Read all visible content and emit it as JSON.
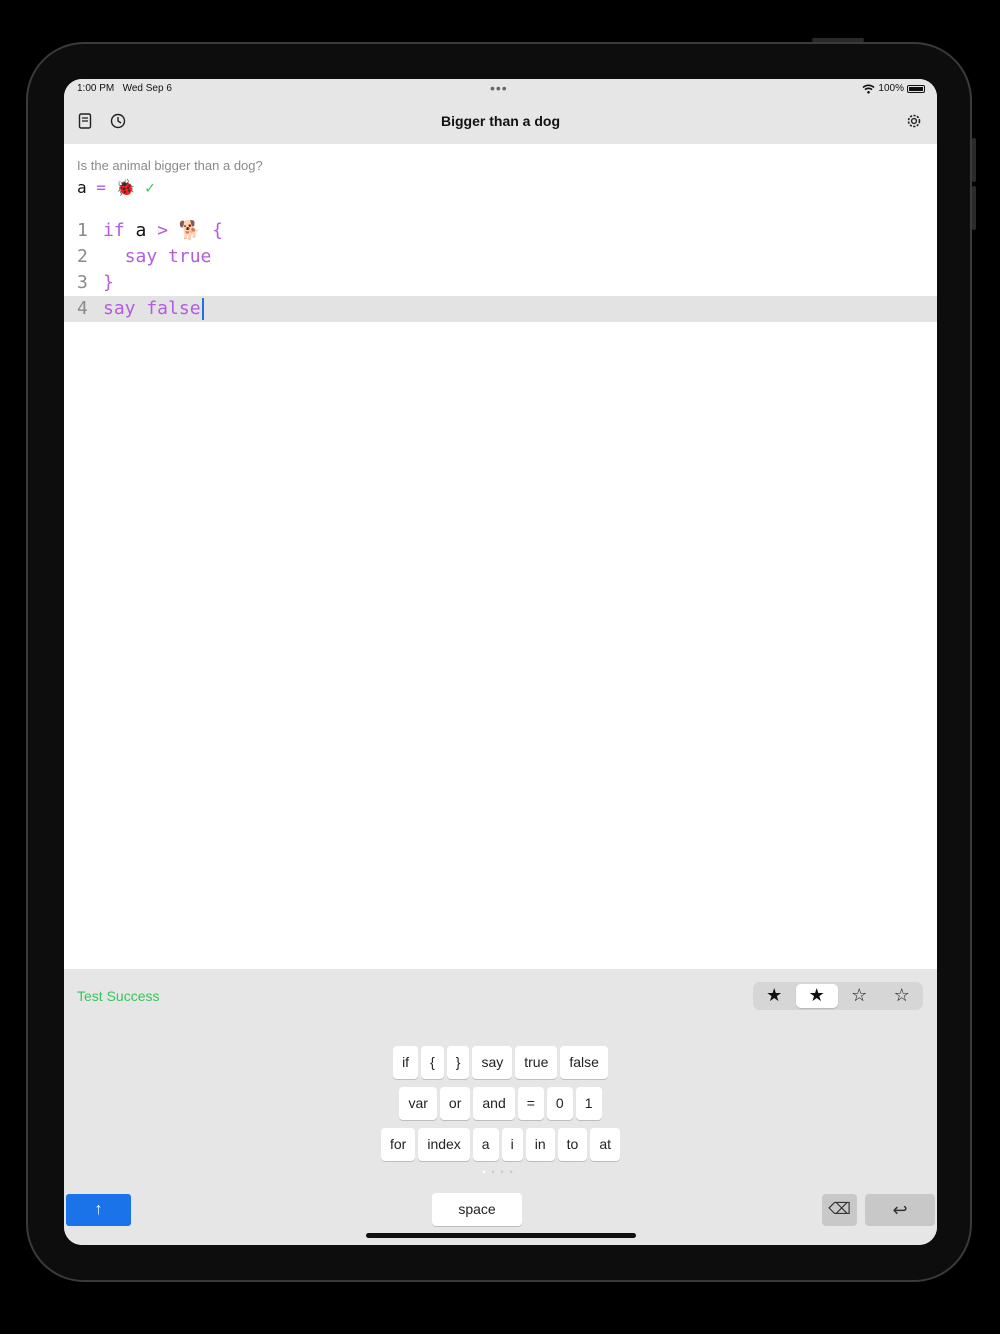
{
  "status_bar": {
    "time": "1:00 PM",
    "date": "Wed Sep 6",
    "dots": "•••",
    "battery": "100%"
  },
  "nav": {
    "title": "Bigger than a dog",
    "left_icons": [
      "document-icon",
      "history-icon"
    ],
    "right_icon": "gear-icon"
  },
  "editor": {
    "prompt": "Is the animal bigger than a dog?",
    "assignment": {
      "var": "a",
      "eq": "=",
      "value": "🐞",
      "check": "✓"
    },
    "lines": [
      {
        "num": "1",
        "kw1": "if",
        "var": "a",
        "rest": " > 🐕 {"
      },
      {
        "num": "2",
        "text": "  say true"
      },
      {
        "num": "3",
        "text": "}"
      },
      {
        "num": "4",
        "text": "say false"
      }
    ]
  },
  "footer": {
    "status": "Test Success",
    "stars": [
      "★",
      "★",
      "☆",
      "☆"
    ],
    "selected_star_index": 1
  },
  "keyboard": {
    "row1": [
      "if",
      "{",
      "}",
      "say",
      "true",
      "false"
    ],
    "row2": [
      "var",
      "or",
      "and",
      "=",
      "0",
      "1"
    ],
    "row3": [
      "for",
      "index",
      "a",
      "i",
      "in",
      "to",
      "at"
    ],
    "page_dots": [
      "•",
      "•",
      "•",
      "•"
    ],
    "current_page": 0,
    "run_label": "↑",
    "space_label": "space",
    "delete_label": "⌫",
    "return_label": "↩"
  },
  "colors": {
    "keyword": "#b35ce0",
    "success": "#34c759",
    "accent": "#1a73e8"
  }
}
